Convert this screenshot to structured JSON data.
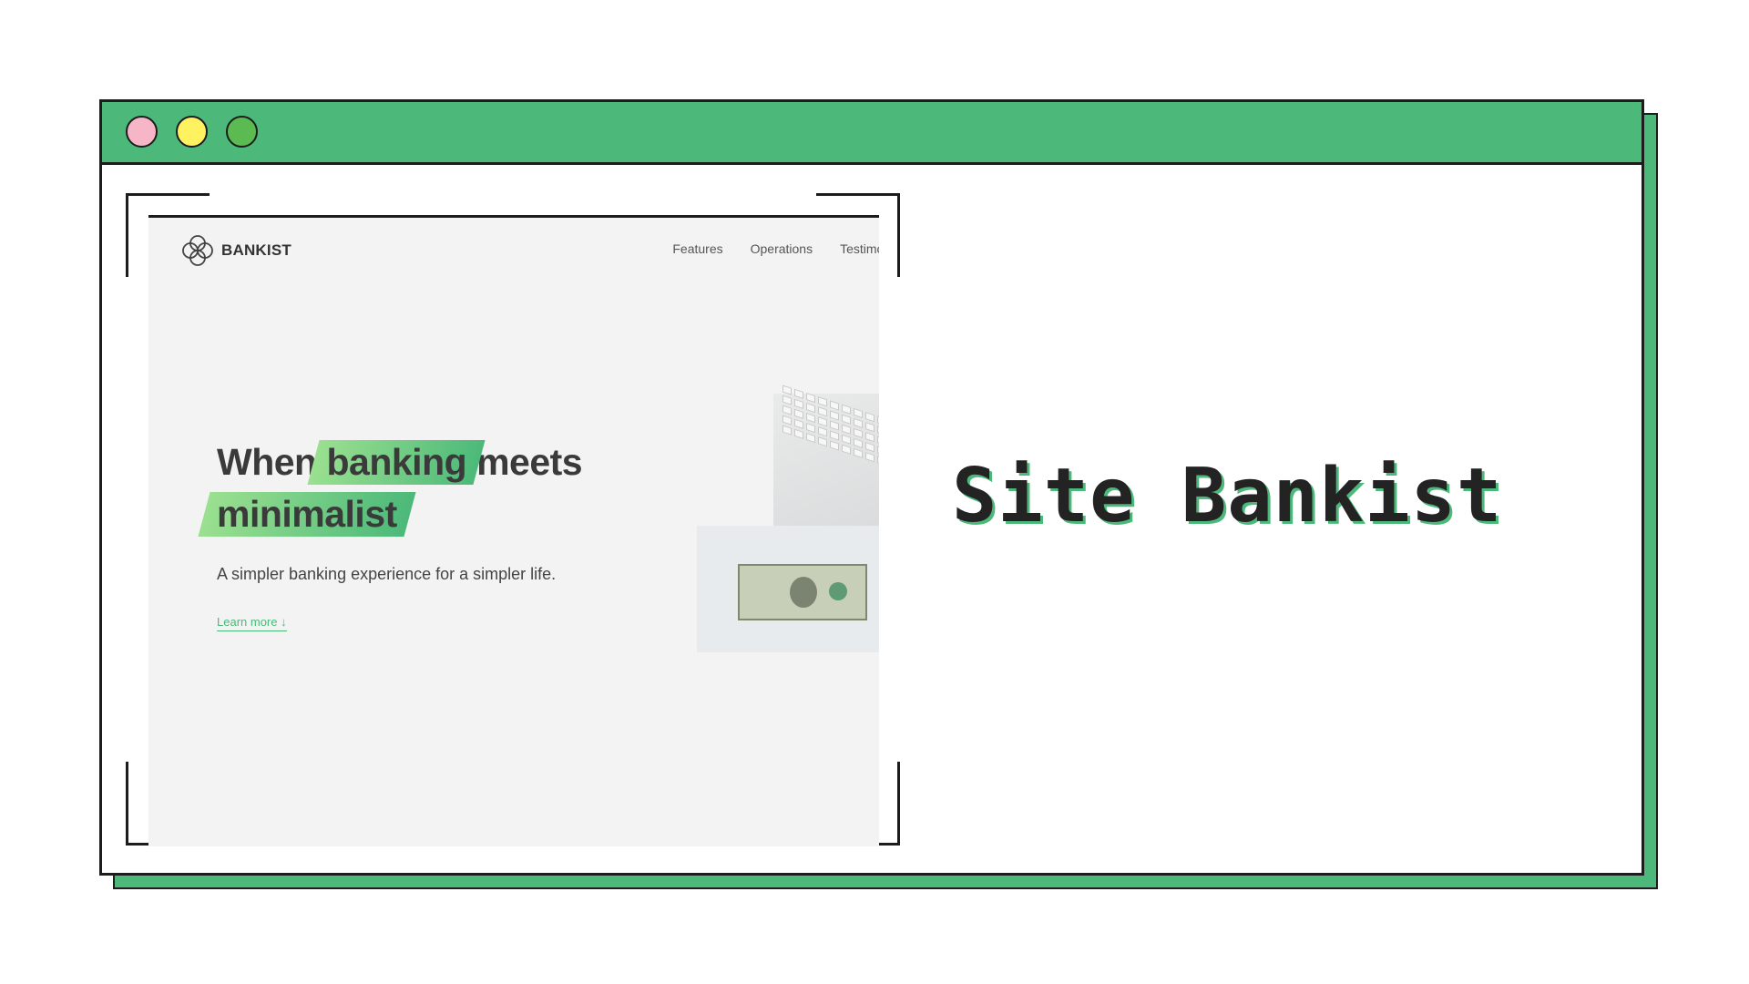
{
  "window": {
    "controls": [
      "close",
      "minimize",
      "maximize"
    ],
    "control_colors": {
      "close": "#f6b6c8",
      "minimize": "#fff261",
      "maximize": "#5cba52"
    },
    "accent_color": "#4cb97a"
  },
  "preview": {
    "brand": "BANKIST",
    "nav": [
      "Features",
      "Operations",
      "Testimor"
    ],
    "hero": {
      "title_plain_1": "When ",
      "title_highlight_1": "banking",
      "title_plain_2": " meets",
      "title_highlight_2": "minimalist",
      "subtitle": "A simpler banking experience for a simpler life.",
      "cta": "Learn more ↓"
    }
  },
  "title": "Site Bankist"
}
